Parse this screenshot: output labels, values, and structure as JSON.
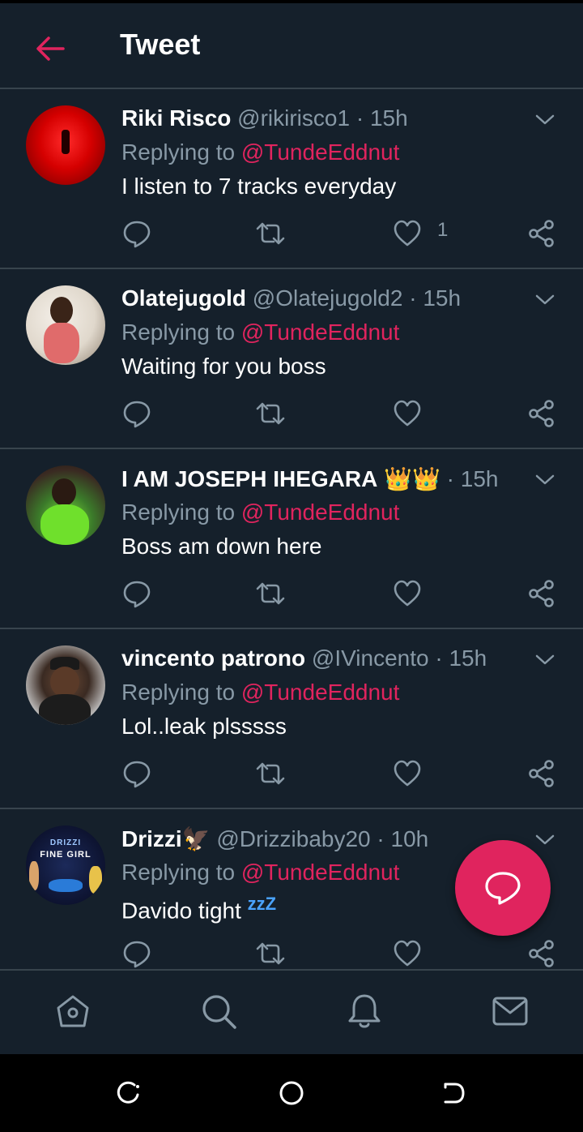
{
  "header": {
    "title": "Tweet"
  },
  "tweets": [
    {
      "name": "Riki Risco",
      "emoji": "",
      "handle": "@rikirisco1",
      "time": "15h",
      "replying_prefix": "Replying to ",
      "replying_to": "@TundeEddnut",
      "text": "I listen to 7 tracks everyday",
      "text_suffix": "",
      "like_count": "1"
    },
    {
      "name": "Olatejugold",
      "emoji": "",
      "handle": "@Olatejugold2",
      "time": "15h",
      "replying_prefix": "Replying to ",
      "replying_to": "@TundeEddnut",
      "text": "Waiting for you boss",
      "text_suffix": "",
      "like_count": ""
    },
    {
      "name": "I AM JOSEPH IHEGARA",
      "emoji": "👑👑",
      "handle": "",
      "time": "15h",
      "replying_prefix": "Replying to ",
      "replying_to": "@TundeEddnut",
      "text": "Boss am down here",
      "text_suffix": "",
      "like_count": ""
    },
    {
      "name": "vincento patrono",
      "emoji": "",
      "handle": "@IVincento",
      "time": "15h",
      "replying_prefix": "Replying to ",
      "replying_to": "@TundeEddnut",
      "text": "Lol..leak plsssss",
      "text_suffix": "",
      "like_count": ""
    },
    {
      "name": "Drizzi",
      "emoji": "🦅",
      "handle": "@Drizzibaby20",
      "time": "10h",
      "replying_prefix": "Replying to ",
      "replying_to": "@TundeEddnut",
      "text": "Davido tight ",
      "text_suffix": "zzZ",
      "like_count": "",
      "avatar_text": "DRIZZI",
      "avatar_subtext": "FINE GIRL"
    }
  ],
  "colors": {
    "background": "#15202b",
    "accent": "#e0245e",
    "muted": "#8899a6",
    "divider": "#38444d"
  },
  "icons": {
    "back": "arrow-left-icon",
    "caret": "chevron-down-icon",
    "reply": "reply-icon",
    "retweet": "retweet-icon",
    "like": "heart-icon",
    "share": "share-icon",
    "compose": "compose-reply-icon",
    "home": "home-icon",
    "search": "search-icon",
    "notifications": "bell-icon",
    "messages": "mail-icon"
  }
}
